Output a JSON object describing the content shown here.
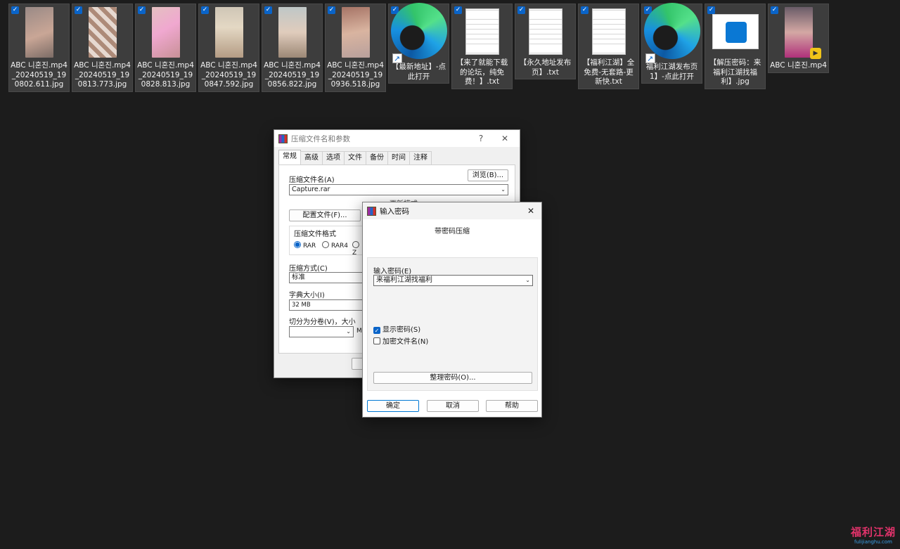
{
  "desktop": {
    "files": [
      {
        "name": "ABC 니혼진.mp4_20240519_190802.611.jpg",
        "icon": "image-thumbnail",
        "selected": true
      },
      {
        "name": "ABC 니혼진.mp4_20240519_190813.773.jpg",
        "icon": "image-thumbnail",
        "selected": true
      },
      {
        "name": "ABC 니혼진.mp4_20240519_190828.813.jpg",
        "icon": "image-thumbnail",
        "selected": true
      },
      {
        "name": "ABC 니혼진.mp4_20240519_190847.592.jpg",
        "icon": "image-thumbnail",
        "selected": true
      },
      {
        "name": "ABC 니혼진.mp4_20240519_190856.822.jpg",
        "icon": "image-thumbnail",
        "selected": true
      },
      {
        "name": "ABC 니혼진.mp4_20240519_190936.518.jpg",
        "icon": "image-thumbnail",
        "selected": true
      },
      {
        "name": "【最新地址】-点此打开",
        "icon": "edge-shortcut-icon",
        "selected": true
      },
      {
        "name": "【来了就能下载的论坛，纯免费！】.txt",
        "icon": "text-file-icon",
        "selected": true
      },
      {
        "name": "【永久地址发布页】.txt",
        "icon": "text-file-icon",
        "selected": true
      },
      {
        "name": "【福利江湖】全免费-无套路-更新快.txt",
        "icon": "text-file-icon",
        "selected": true
      },
      {
        "name": "福利江湖发布页1】-点此打开",
        "icon": "edge-shortcut-icon",
        "selected": true
      },
      {
        "name": "【解压密码：来福利江湖找福利】.jpg",
        "icon": "photo-file-icon",
        "selected": true
      },
      {
        "name": "ABC 니혼진.mp4",
        "icon": "video-thumbnail",
        "selected": true
      }
    ]
  },
  "archive_dialog": {
    "title": "压缩文件名和参数",
    "help_btn": "?",
    "close_btn": "✕",
    "tabs": [
      "常规",
      "高级",
      "选项",
      "文件",
      "备份",
      "时间",
      "注释"
    ],
    "archive_name_label": "压缩文件名(A)",
    "browse_btn": "浏览(B)...",
    "archive_name_value": "Capture.rar",
    "hidden_text": "更新模式",
    "profiles_btn": "配置文件(F)...",
    "format_group": "压缩文件格式",
    "format_options": [
      "RAR",
      "RAR4",
      "Z"
    ],
    "method_label": "压缩方式(C)",
    "method_value": "标准",
    "dict_label": "字典大小(I)",
    "dict_value": "32 MB",
    "split_label": "切分为分卷(V)，大小",
    "split_value": "",
    "split_unit": "MI"
  },
  "password_dialog": {
    "title": "输入密码",
    "close_btn": "✕",
    "heading": "带密码压缩",
    "password_label": "输入密码(E)",
    "password_value": "来福利江湖找福利",
    "show_password_label": "显示密码(S)",
    "show_password_checked": true,
    "encrypt_names_label": "加密文件名(N)",
    "encrypt_names_checked": false,
    "organize_btn": "整理密码(O)...",
    "ok_btn": "确定",
    "cancel_btn": "取消",
    "help_btn": "帮助"
  },
  "watermark": {
    "line1": "福利江湖",
    "line2": "fulijianghu.com"
  }
}
